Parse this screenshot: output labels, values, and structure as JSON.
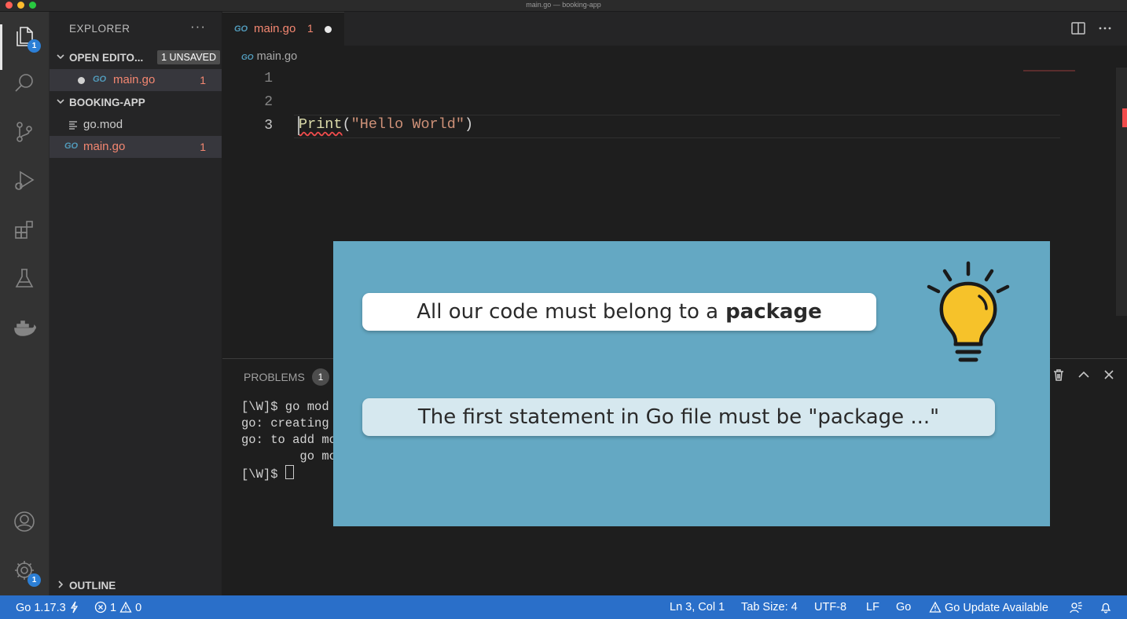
{
  "window": {
    "title": "main.go — booking-app"
  },
  "activity_bar": {
    "explorer_badge": "1",
    "settings_badge": "1"
  },
  "sidebar": {
    "header": "EXPLORER",
    "more": "···",
    "open_editors": {
      "label": "OPEN EDITO...",
      "unsaved_badge": "1 UNSAVED",
      "items": [
        {
          "name": "main.go",
          "problems": "1"
        }
      ]
    },
    "project": {
      "label": "BOOKING-APP",
      "files": [
        {
          "name": "go.mod"
        },
        {
          "name": "main.go",
          "problems": "1"
        }
      ]
    },
    "outline": {
      "label": "OUTLINE"
    }
  },
  "tab": {
    "icon_text": "GO",
    "name": "main.go",
    "problems": "1"
  },
  "breadcrumb": {
    "icon_text": "GO",
    "file": "main.go"
  },
  "editor": {
    "line_numbers": [
      "1",
      "2",
      "3"
    ],
    "code": {
      "fn": "Print",
      "open": "(",
      "str": "\"Hello World\"",
      "close": ")"
    }
  },
  "panel": {
    "problems_label": "PROBLEMS",
    "problems_count": "1",
    "terminal_lines": [
      "[\\W]$ go mod i",
      "go: creating",
      "go: to add modu",
      "        go mod tidy",
      "[\\W]$ "
    ]
  },
  "overlay": {
    "line1_prefix": "All our code must belong to a",
    "line1_bold": "package",
    "line2": "The first statement in Go file must be \"package ...\""
  },
  "statusbar": {
    "go_version": "Go 1.17.3",
    "errors": "1",
    "warnings": "0",
    "position": "Ln 3, Col 1",
    "tab_size": "Tab Size: 4",
    "encoding": "UTF-8",
    "eol": "LF",
    "language": "Go",
    "update": "Go Update Available"
  },
  "colors": {
    "statusbar": "#2a6fc9",
    "overlay": "#64a8c3",
    "error": "#f48771",
    "go_icon": "#519aba"
  }
}
